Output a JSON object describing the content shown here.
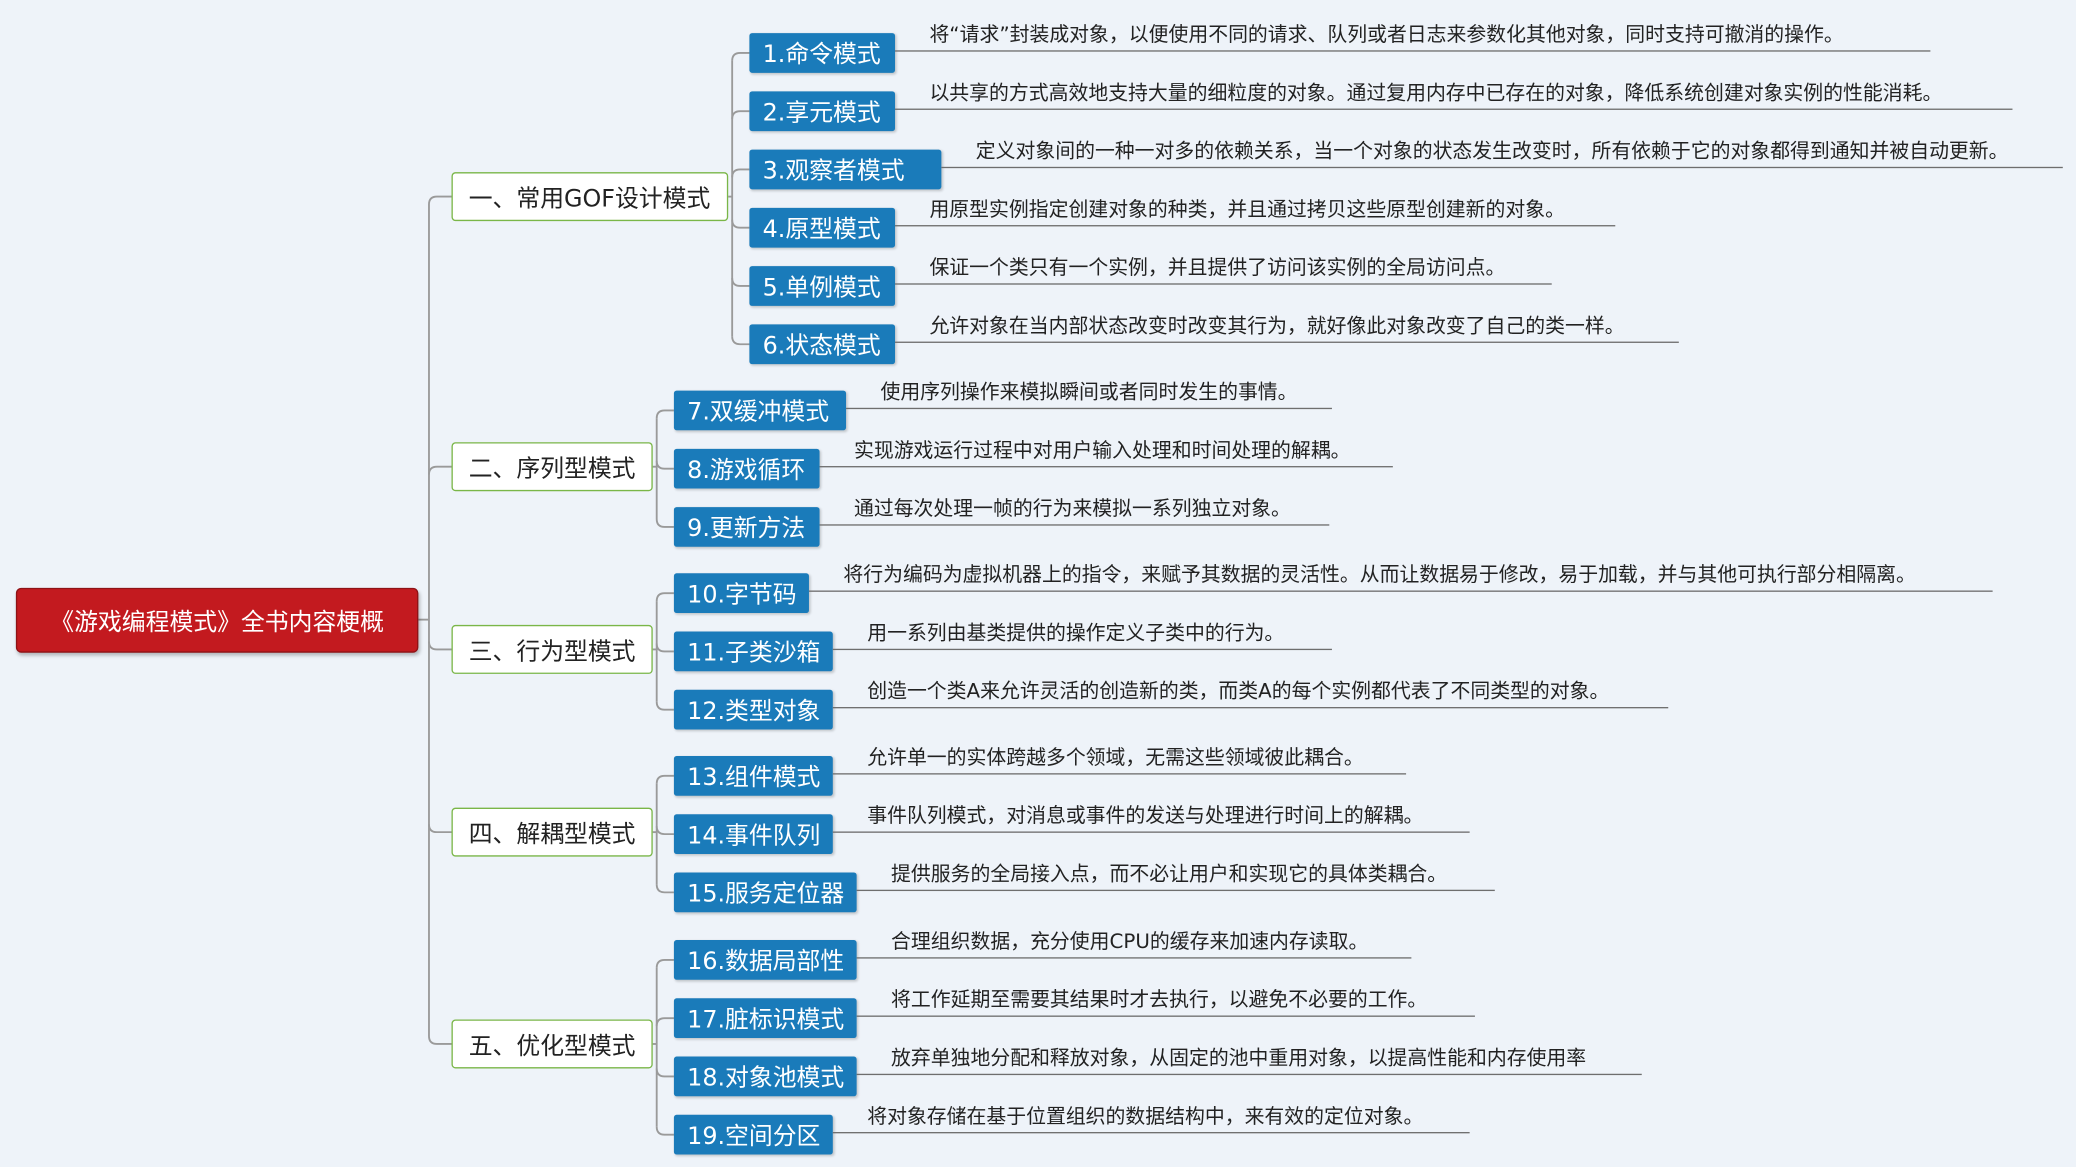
{
  "root": {
    "title": "《游戏编程模式》全书内容梗概"
  },
  "colors": {
    "background": "#EEF3F9",
    "root": "#C31A1F",
    "pattern": "#1A7BBA",
    "category_border": "#7AB648",
    "connector": "#9A9A9A"
  },
  "categories": [
    {
      "label": "一、常用GOF设计模式",
      "patterns": [
        {
          "label": "1.命令模式",
          "desc": "将“请求”封装成对象，以便使用不同的请求、队列或者日志来参数化其他对象，同时支持可撤消的操作。"
        },
        {
          "label": "2.享元模式",
          "desc": "以共享的方式高效地支持大量的细粒度的对象。通过复用内存中已存在的对象，降低系统创建对象实例的性能消耗。"
        },
        {
          "label": "3.观察者模式",
          "desc": "定义对象间的一种一对多的依赖关系，当一个对象的状态发生改变时，所有依赖于它的对象都得到通知并被自动更新。"
        },
        {
          "label": "4.原型模式",
          "desc": "用原型实例指定创建对象的种类，并且通过拷贝这些原型创建新的对象。"
        },
        {
          "label": "5.单例模式",
          "desc": "保证一个类只有一个实例，并且提供了访问该实例的全局访问点。"
        },
        {
          "label": "6.状态模式",
          "desc": "允许对象在当内部状态改变时改变其行为，就好像此对象改变了自己的类一样。"
        }
      ]
    },
    {
      "label": "二、序列型模式",
      "patterns": [
        {
          "label": "7.双缓冲模式",
          "desc": "使用序列操作来模拟瞬间或者同时发生的事情。"
        },
        {
          "label": "8.游戏循环",
          "desc": "实现游戏运行过程中对用户输入处理和时间处理的解耦。"
        },
        {
          "label": "9.更新方法",
          "desc": "通过每次处理一帧的行为来模拟一系列独立对象。"
        }
      ]
    },
    {
      "label": "三、行为型模式",
      "patterns": [
        {
          "label": "10.字节码",
          "desc": "将行为编码为虚拟机器上的指令，来赋予其数据的灵活性。从而让数据易于修改，易于加载，并与其他可执行部分相隔离。"
        },
        {
          "label": "11.子类沙箱",
          "desc": "用一系列由基类提供的操作定义子类中的行为。"
        },
        {
          "label": "12.类型对象",
          "desc": "创造一个类A来允许灵活的创造新的类，而类A的每个实例都代表了不同类型的对象。"
        }
      ]
    },
    {
      "label": "四、解耦型模式",
      "patterns": [
        {
          "label": "13.组件模式",
          "desc": "允许单一的实体跨越多个领域，无需这些领域彼此耦合。"
        },
        {
          "label": "14.事件队列",
          "desc": "事件队列模式，对消息或事件的发送与处理进行时间上的解耦。"
        },
        {
          "label": "15.服务定位器",
          "desc": "提供服务的全局接入点，而不必让用户和实现它的具体类耦合。"
        }
      ]
    },
    {
      "label": "五、优化型模式",
      "patterns": [
        {
          "label": "16.数据局部性",
          "desc": "合理组织数据，充分使用CPU的缓存来加速内存读取。"
        },
        {
          "label": "17.脏标识模式",
          "desc": "将工作延期至需要其结果时才去执行，以避免不必要的工作。"
        },
        {
          "label": "18.对象池模式",
          "desc": "放弃单独地分配和释放对象，从固定的池中重用对象，以提高性能和内存使用率"
        },
        {
          "label": "19.空间分区",
          "desc": "将对象存储在基于位置组织的数据结构中，来有效的定位对象。"
        }
      ]
    }
  ]
}
